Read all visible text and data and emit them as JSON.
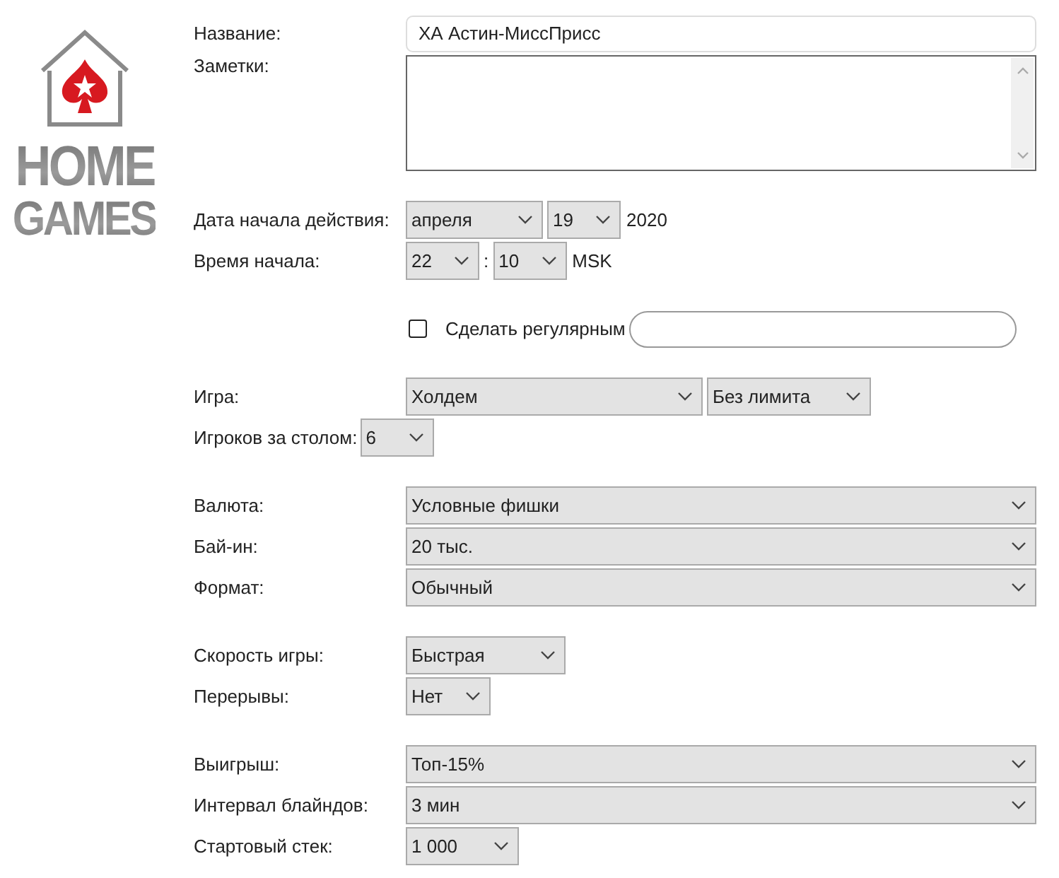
{
  "logo": {
    "lines": [
      "HOME",
      "GAMES"
    ]
  },
  "sections": [
    {
      "rows": [
        {
          "kind": "text",
          "label": "Название:",
          "value": "ХА Астин-МиссПрисс"
        },
        {
          "kind": "textarea",
          "label": "Заметки:"
        }
      ]
    },
    {
      "rows": [
        {
          "kind": "date",
          "label": "Дата начала действия:",
          "selects": [
            "апреля",
            "19"
          ],
          "suffix": "2020"
        },
        {
          "kind": "time",
          "label": "Время начала:",
          "selects": [
            "22",
            "10"
          ],
          "separator": ":",
          "suffix": "MSK"
        }
      ]
    },
    {
      "rows": [
        {
          "kind": "checkbox",
          "label": "Сделать регулярным",
          "checked": false
        }
      ]
    },
    {
      "rows": [
        {
          "kind": "game",
          "label": "Игра:",
          "selects": [
            "Холдем",
            "Без лимита"
          ]
        },
        {
          "kind": "players",
          "label": "Игроков за столом:",
          "selects": [
            "6"
          ]
        }
      ]
    },
    {
      "rows": [
        {
          "kind": "wide",
          "label": "Валюта:",
          "selects": [
            "Условные фишки"
          ]
        },
        {
          "kind": "wide",
          "label": "Бай-ин:",
          "selects": [
            "20 тыс."
          ]
        },
        {
          "kind": "wide",
          "label": "Формат:",
          "selects": [
            "Обычный"
          ]
        }
      ]
    },
    {
      "rows": [
        {
          "kind": "short",
          "label": "Скорость игры:",
          "selects": [
            "Быстрая"
          ]
        },
        {
          "kind": "short",
          "label": "Перерывы:",
          "selects": [
            "Нет"
          ]
        }
      ]
    },
    {
      "rows": [
        {
          "kind": "wide",
          "label": "Выигрыш:",
          "selects": [
            "Топ-15%"
          ]
        },
        {
          "kind": "wide",
          "label": "Интервал блайндов:",
          "selects": [
            "3 мин"
          ]
        },
        {
          "kind": "short",
          "label": "Стартовый стек:",
          "selects": [
            "1 000"
          ]
        }
      ]
    }
  ]
}
